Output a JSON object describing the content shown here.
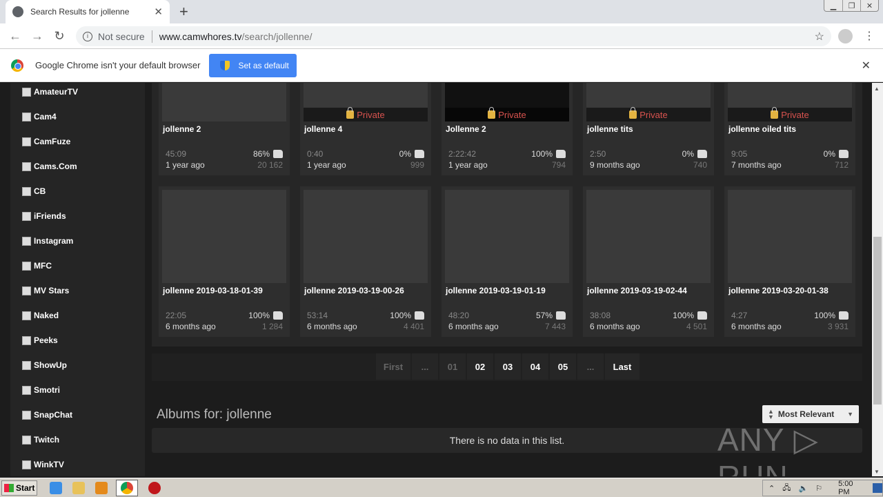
{
  "browser": {
    "tab_title": "Search Results for jollenne",
    "new_tab_label": "+",
    "security_label": "Not secure",
    "url_host": "www.camwhores.tv",
    "url_path": "/search/jollenne/",
    "infobar_message": "Google Chrome isn't your default browser",
    "set_default_label": "Set as default"
  },
  "sidebar": {
    "items": [
      "AmateurTV",
      "Cam4",
      "CamFuze",
      "Cams.Com",
      "CB",
      "iFriends",
      "Instagram",
      "MFC",
      "MV Stars",
      "Naked",
      "Peeks",
      "ShowUp",
      "Smotri",
      "SnapChat",
      "Twitch",
      "WinkTV"
    ]
  },
  "videos": [
    {
      "title": "jollenne 2",
      "duration": "45:09",
      "rating": "86%",
      "age": "1 year ago",
      "views": "20 162",
      "private": false
    },
    {
      "title": "jollenne 4",
      "duration": "0:40",
      "rating": "0%",
      "age": "1 year ago",
      "views": "999",
      "private": true,
      "private_label": "Private"
    },
    {
      "title": "Jollenne 2",
      "duration": "2:22:42",
      "rating": "100%",
      "age": "1 year ago",
      "views": "794",
      "private": true,
      "private_label": "Private"
    },
    {
      "title": "jollenne tits",
      "duration": "2:50",
      "rating": "0%",
      "age": "9 months ago",
      "views": "740",
      "private": true,
      "private_label": "Private"
    },
    {
      "title": "jollenne oiled tits",
      "duration": "9:05",
      "rating": "0%",
      "age": "7 months ago",
      "views": "712",
      "private": true,
      "private_label": "Private"
    },
    {
      "title": "jollenne 2019-03-18-01-39",
      "duration": "22:05",
      "rating": "100%",
      "age": "6 months ago",
      "views": "1 284",
      "private": false
    },
    {
      "title": "jollenne 2019-03-19-00-26",
      "duration": "53:14",
      "rating": "100%",
      "age": "6 months ago",
      "views": "4 401",
      "private": false
    },
    {
      "title": "jollenne 2019-03-19-01-19",
      "duration": "48:20",
      "rating": "57%",
      "age": "6 months ago",
      "views": "7 443",
      "private": false
    },
    {
      "title": "jollenne 2019-03-19-02-44",
      "duration": "38:08",
      "rating": "100%",
      "age": "6 months ago",
      "views": "4 501",
      "private": false
    },
    {
      "title": "jollenne 2019-03-20-01-38",
      "duration": "4:27",
      "rating": "100%",
      "age": "6 months ago",
      "views": "3 931",
      "private": false
    }
  ],
  "pagination": {
    "items": [
      {
        "label": "First",
        "dim": true
      },
      {
        "label": "...",
        "dim": true
      },
      {
        "label": "01",
        "dim": true
      },
      {
        "label": "02",
        "dim": false
      },
      {
        "label": "03",
        "dim": false
      },
      {
        "label": "04",
        "dim": false
      },
      {
        "label": "05",
        "dim": false
      },
      {
        "label": "...",
        "dim": true
      },
      {
        "label": "Last",
        "dim": false
      }
    ]
  },
  "albums": {
    "title": "Albums for: jollenne",
    "sort_label": "Most Relevant",
    "empty_message": "There is no data in this list."
  },
  "watermark": "ANY ▷ RUN",
  "taskbar": {
    "start_label": "Start",
    "clock": "5:00 PM"
  }
}
